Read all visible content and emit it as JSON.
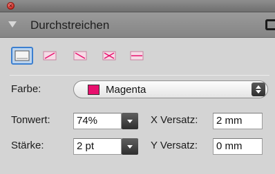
{
  "window": {
    "close_glyph": "×"
  },
  "panel": {
    "title": "Durchstreichen",
    "disclosure_icon": "triangle-down-icon",
    "menu_icon": "panel-menu-icon"
  },
  "tools": [
    {
      "icon": "strike-none-icon",
      "selected": true
    },
    {
      "icon": "strike-diagonal-up-icon",
      "selected": false
    },
    {
      "icon": "strike-diagonal-down-icon",
      "selected": false
    },
    {
      "icon": "strike-cross-icon",
      "selected": false
    },
    {
      "icon": "strike-horizontal-icon",
      "selected": false
    }
  ],
  "farbe": {
    "label": "Farbe:",
    "value": "Magenta",
    "swatch_color": "#e8106e"
  },
  "tonwert": {
    "label": "Tonwert:",
    "value": "74%"
  },
  "staerke": {
    "label": "Stärke:",
    "value": "2 pt"
  },
  "x_versatz": {
    "label": "X Versatz:",
    "value": "2 mm"
  },
  "y_versatz": {
    "label": "Y Versatz:",
    "value": "0 mm"
  },
  "colors": {
    "accent": "#3b7fd0",
    "magenta": "#e8106e"
  }
}
